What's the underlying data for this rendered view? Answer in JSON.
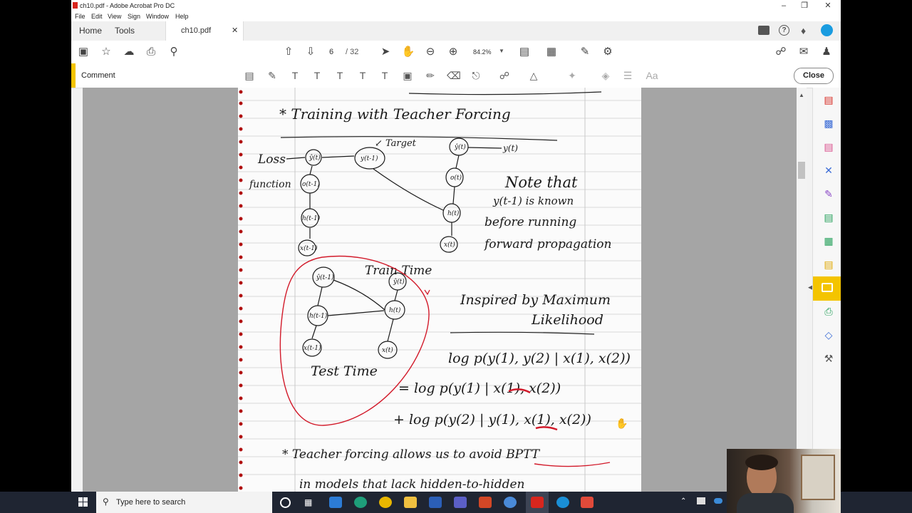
{
  "window": {
    "title": "ch10.pdf - Adobe Acrobat Pro DC"
  },
  "menu": [
    "File",
    "Edit",
    "View",
    "Sign",
    "Window",
    "Help"
  ],
  "tabs": {
    "home": "Home",
    "tools": "Tools",
    "document": "ch10.pdf"
  },
  "toolbar": {
    "page_current": "6",
    "page_total": "/ 32",
    "zoom": "84.2%"
  },
  "comment_bar": {
    "label": "Comment",
    "close": "Close",
    "text_tool": "Aa"
  },
  "notes": {
    "heading": "* Training with Teacher Forcing",
    "target": "↙ Target",
    "loss": "Loss",
    "function": "function",
    "note1": "Note that",
    "note2": "y(t-1) is known",
    "note3": "before running",
    "note4": "forward propagation",
    "train_time": "Train Time",
    "test_time": "Test Time",
    "inspired1": "Inspired by Maximum",
    "inspired2": "Likelihood",
    "eq1": "log p(y(1), y(2) | x(1), x(2))",
    "eq2": "= log p(y(1) | x(1), x(2))",
    "eq3": "+ log p(y(2) | y(1), x(1), x(2))",
    "bullet1": "* Teacher forcing allows us to avoid BPTT",
    "bullet2": "in models that lack hidden-to-hidden",
    "n_ym1": "y(t-1)",
    "n_yt": "y(t)",
    "n_yhat": "ŷ(t)",
    "n_o1": "o(t-1)",
    "n_o2": "o(t)",
    "n_h1": "h(t-1)",
    "n_h2": "h(t)",
    "n_x1": "x(t-1)",
    "n_x2": "x(t)",
    "n_yhat1": "ŷ(t-1)"
  },
  "taskbar": {
    "search_placeholder": "Type here to search"
  },
  "colors": {
    "accent": "#f4c400",
    "pdf_red": "#d7261e",
    "ink": "#1a1a1a",
    "red_ink": "#d21a2a",
    "taskbar": "#1f2532"
  }
}
